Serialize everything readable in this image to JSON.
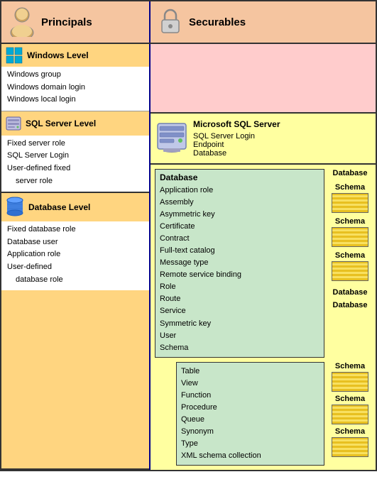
{
  "header": {
    "principals_label": "Principals",
    "securables_label": "Securables"
  },
  "windows_level": {
    "label": "Windows Level",
    "items": [
      "Windows group",
      "Windows domain login",
      "Windows local login"
    ]
  },
  "sqlserver_level": {
    "label": "SQL Server Level",
    "left_items": [
      "Fixed server role",
      "SQL Server Login",
      "User-defined fixed",
      "  server role"
    ],
    "right_title": "Microsoft SQL Server",
    "right_items": [
      "SQL Server Login",
      "Endpoint",
      "Database"
    ]
  },
  "database_level": {
    "label": "Database Level",
    "left_items": [
      "Fixed database role",
      "Database user",
      "Application role",
      "User-defined",
      "  database role"
    ],
    "db_box": {
      "title": "Database",
      "items": [
        "Application role",
        "Assembly",
        "Asymmetric key",
        "Certificate",
        "Contract",
        "Full-text catalog",
        "Message type",
        "Remote service binding",
        "Role",
        "Route",
        "Service",
        "Symmetric key",
        "User",
        "Schema"
      ]
    },
    "schema_labels": [
      "Schema",
      "Schema",
      "Schema"
    ],
    "sub_db_box": {
      "items": [
        "Table",
        "View",
        "Function",
        "Procedure",
        "Queue",
        "Synonym",
        "Type",
        "XML schema collection"
      ]
    },
    "sub_schema_labels": [
      "Schema",
      "Schema"
    ],
    "db_small_labels": [
      "Database",
      "Database"
    ]
  }
}
